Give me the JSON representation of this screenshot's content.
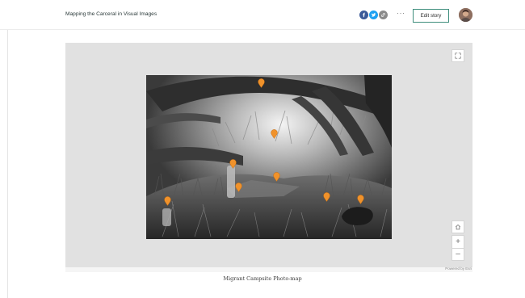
{
  "header": {
    "story_title": "Mapping the Carceral in Visual Images",
    "more_label": "···",
    "edit_button_label": "Edit story",
    "share_icons": [
      "facebook-icon",
      "twitter-icon",
      "link-icon"
    ]
  },
  "map": {
    "pin_count": 9,
    "pin_color": "#f0922b",
    "attribution": "Powered by Esri",
    "controls": {
      "zoom_in_label": "+",
      "zoom_out_label": "–"
    }
  },
  "caption": "Migrant Campsite Photo-map",
  "colors": {
    "accent": "#3f8e7d",
    "map_background": "#e1e1e1",
    "facebook": "#3b5998",
    "twitter": "#1da1f2"
  }
}
